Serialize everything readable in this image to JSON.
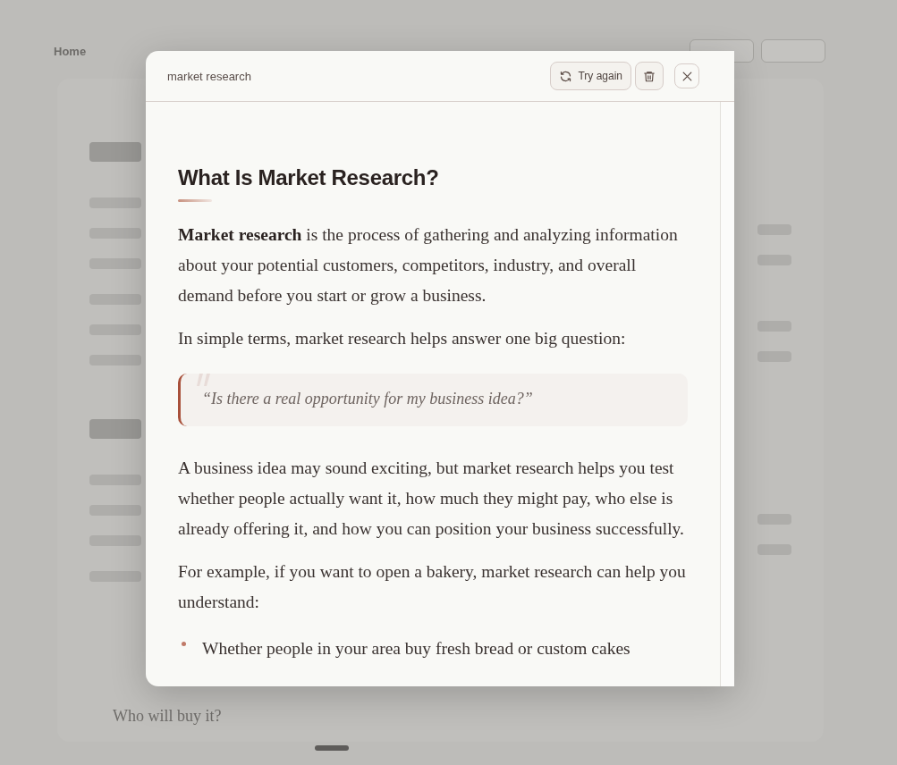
{
  "background": {
    "back_link": "Home",
    "visible_item": "Who will buy it?"
  },
  "dialog": {
    "title": "market research",
    "buttons": [
      {
        "kind": "retry",
        "label": "Try again"
      },
      {
        "kind": "delete"
      },
      {
        "kind": "close"
      }
    ],
    "article": {
      "heading": "What Is Market Research?",
      "blocks": [
        {
          "kind": "paragraph",
          "text": "**Market research** is the process of gathering and analyzing information about your potential customers, competitors, industry, and overall demand before you start or grow a business."
        },
        {
          "kind": "paragraph",
          "text": "In simple terms, market research helps answer one big question:"
        },
        {
          "kind": "quote",
          "text": "“Is there a real opportunity for my business idea?”"
        },
        {
          "kind": "paragraph",
          "text": "A business idea may sound exciting, but market research helps you test whether people actually want it, how much they might pay, who else is already offering it, and how you can position your business successfully."
        },
        {
          "kind": "paragraph",
          "text": "For example, if you want to open a bakery, market research can help you understand:"
        },
        {
          "kind": "bullets",
          "items": [
            "Whether people in your area buy fresh bread or custom cakes"
          ]
        }
      ]
    }
  }
}
